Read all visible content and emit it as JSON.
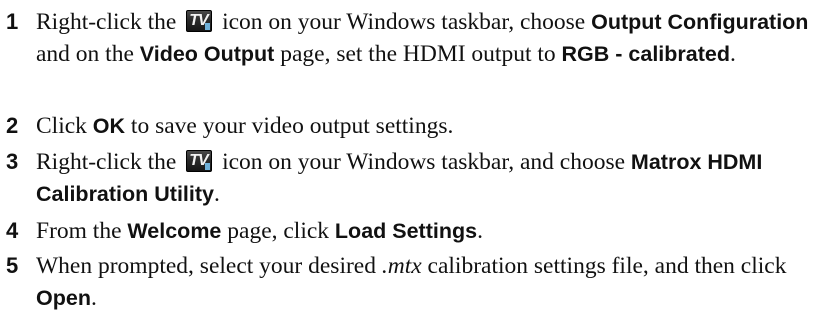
{
  "steps": [
    {
      "number": "1",
      "t1": "Right-click the",
      "t2": "icon on your Windows taskbar, choose",
      "b1": "Output Configuration",
      "t3": "and on the",
      "b2": "Video Output",
      "t4": "page, set the HDMI output to",
      "b3": "RGB - calibrated",
      "t5": "."
    },
    {
      "number": "2",
      "t1": "Click",
      "b1": "OK",
      "t2": "to save your video output settings."
    },
    {
      "number": "3",
      "t1": "Right-click the",
      "t2": "icon on your Windows taskbar, and choose",
      "b1": "Matrox HDMI Calibration Utility",
      "t3": "."
    },
    {
      "number": "4",
      "t1": "From the",
      "b1": "Welcome",
      "t2": "page, click",
      "b2": "Load Settings",
      "t3": "."
    },
    {
      "number": "5",
      "t1": "When prompted, select your desired",
      "i1": ".mtx",
      "t2": "calibration settings file, and then click",
      "b1": "Open",
      "t3": "."
    }
  ],
  "icon": {
    "name": "matrox-tv-icon",
    "label": "TV",
    "colors": {
      "background": "#2a2a2a",
      "accent": "#6fb0d8",
      "text": "#f2f2f2"
    }
  }
}
